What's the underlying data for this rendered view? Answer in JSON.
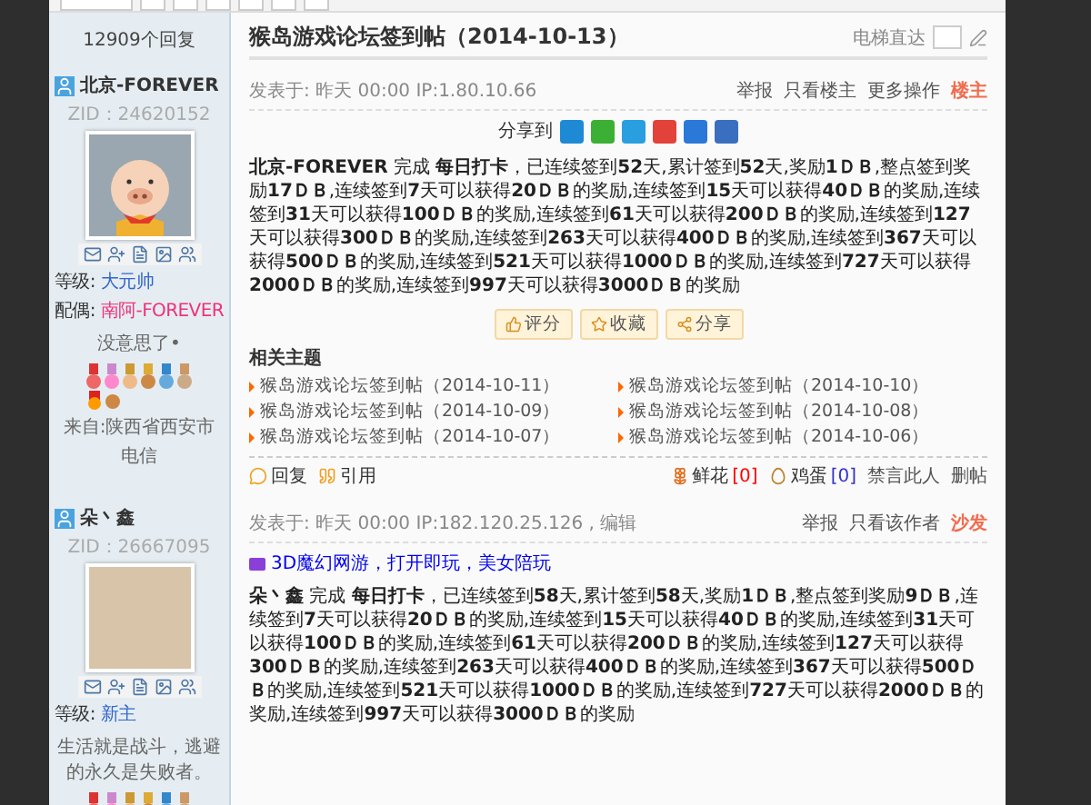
{
  "thread": {
    "reply_count": "12909个回复",
    "title": "猴岛游戏论坛签到帖（2014-10-13）",
    "jump_label": "电梯直达"
  },
  "posts": [
    {
      "author": "北京-FOREVER",
      "zid": "ZID：24620152",
      "kind": "cartoon",
      "level_label": "等级:",
      "level": "大元帅",
      "spouse_label": "配偶:",
      "spouse": "南阿-FOREVER",
      "signature": "没意思了•",
      "location": "来自:陕西省西安市",
      "isp": "电信",
      "meta": "发表于: 昨天 00:00    IP:1.80.10.66",
      "actions": [
        "举报",
        "只看楼主",
        "更多操作"
      ],
      "floor": "楼主",
      "share_label": "分享到",
      "body": "**北京-FOREVER** 完成 **每日打卡**，已连续签到**52**天,累计签到**52**天,奖励**1ＤＢ**,整点签到奖励**17ＤＢ**,连续签到**7**天可以获得**20ＤＢ**的奖励,连续签到**15**天可以获得**40ＤＢ**的奖励,连续签到**31**天可以获得**100ＤＢ**的奖励,连续签到**61**天可以获得**200ＤＢ**的奖励,连续签到**127**天可以获得**300ＤＢ**的奖励,连续签到**263**天可以获得**400ＤＢ**的奖励,连续签到**367**天可以获得**500ＤＢ**的奖励,连续签到**521**天可以获得**1000ＤＢ**的奖励,连续签到**727**天可以获得**2000ＤＢ**的奖励,连续签到**997**天可以获得**3000ＤＢ**的奖励",
      "rate_buttons": [
        "评分",
        "收藏",
        "分享"
      ],
      "related_title": "相关主题",
      "related": [
        "猴岛游戏论坛签到帖（2014-10-11）",
        "猴岛游戏论坛签到帖（2014-10-10）",
        "猴岛游戏论坛签到帖（2014-10-09）",
        "猴岛游戏论坛签到帖（2014-10-08）",
        "猴岛游戏论坛签到帖（2014-10-07）",
        "猴岛游戏论坛签到帖（2014-10-06）"
      ],
      "footer_left": [
        "回复",
        "引用"
      ],
      "flowers": {
        "label": "鲜花",
        "count": "[0]"
      },
      "eggs": {
        "label": "鸡蛋",
        "count": "[0]"
      },
      "footer_right": [
        "禁言此人",
        "删帖"
      ]
    },
    {
      "author": "朵丶鑫",
      "zid": "ZID：26667095",
      "kind": "photo",
      "level_label": "等级:",
      "level": "新主",
      "signature": "生活就是战斗，逃避的永久是失败者。",
      "meta": "发表于: 昨天 00:00    IP:182.120.25.126 , 编辑",
      "actions": [
        "举报",
        "只看该作者"
      ],
      "floor": "沙发",
      "ad": "3D魔幻网游，打开即玩，美女陪玩",
      "body": "**朵丶鑫** 完成 **每日打卡**，已连续签到**58**天,累计签到**58**天,奖励**1ＤＢ**,整点签到奖励**9ＤＢ**,连续签到**7**天可以获得**20ＤＢ**的奖励,连续签到**15**天可以获得**40ＤＢ**的奖励,连续签到**31**天可以获得**100ＤＢ**的奖励,连续签到**61**天可以获得**200ＤＢ**的奖励,连续签到**127**天可以获得**300ＤＢ**的奖励,连续签到**263**天可以获得**400ＤＢ**的奖励,连续签到**367**天可以获得**500ＤＢ**的奖励,连续签到**521**天可以获得**1000ＤＢ**的奖励,连续签到**727**天可以获得**2000ＤＢ**的奖励,连续签到**997**天可以获得**3000ＤＢ**的奖励"
    }
  ]
}
